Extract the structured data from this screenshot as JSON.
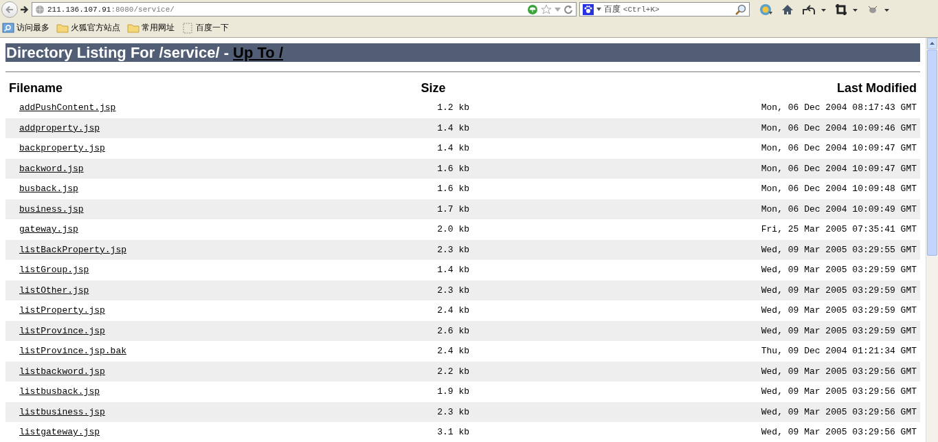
{
  "browser": {
    "url_host": "211.136.107.91",
    "url_path": ":8080/service/",
    "search_engine": "百度",
    "search_hint": "<Ctrl+K>",
    "bookmarks": [
      {
        "kind": "search",
        "label": "访问最多"
      },
      {
        "kind": "folder",
        "label": "火狐官方站点"
      },
      {
        "kind": "folder",
        "label": "常用网址"
      },
      {
        "kind": "page",
        "label": "百度一下"
      }
    ]
  },
  "page": {
    "heading": "Directory Listing For /service/ - ",
    "up_link": "Up To /",
    "columns": [
      "Filename",
      "Size",
      "Last Modified"
    ],
    "rows": [
      {
        "name": "addPushContent.jsp",
        "size": "1.2 kb",
        "modified": "Mon, 06 Dec 2004 08:17:43 GMT"
      },
      {
        "name": "addproperty.jsp",
        "size": "1.4 kb",
        "modified": "Mon, 06 Dec 2004 10:09:46 GMT"
      },
      {
        "name": "backproperty.jsp",
        "size": "1.4 kb",
        "modified": "Mon, 06 Dec 2004 10:09:47 GMT"
      },
      {
        "name": "backword.jsp",
        "size": "1.6 kb",
        "modified": "Mon, 06 Dec 2004 10:09:47 GMT"
      },
      {
        "name": "busback.jsp",
        "size": "1.6 kb",
        "modified": "Mon, 06 Dec 2004 10:09:48 GMT"
      },
      {
        "name": "business.jsp",
        "size": "1.7 kb",
        "modified": "Mon, 06 Dec 2004 10:09:49 GMT"
      },
      {
        "name": "gateway.jsp",
        "size": "2.0 kb",
        "modified": "Fri, 25 Mar 2005 07:35:41 GMT"
      },
      {
        "name": "listBackProperty.jsp",
        "size": "2.3 kb",
        "modified": "Wed, 09 Mar 2005 03:29:55 GMT"
      },
      {
        "name": "listGroup.jsp",
        "size": "1.4 kb",
        "modified": "Wed, 09 Mar 2005 03:29:59 GMT"
      },
      {
        "name": "listOther.jsp",
        "size": "2.3 kb",
        "modified": "Wed, 09 Mar 2005 03:29:59 GMT"
      },
      {
        "name": "listProperty.jsp",
        "size": "2.4 kb",
        "modified": "Wed, 09 Mar 2005 03:29:59 GMT"
      },
      {
        "name": "listProvince.jsp",
        "size": "2.6 kb",
        "modified": "Wed, 09 Mar 2005 03:29:59 GMT"
      },
      {
        "name": "listProvince.jsp.bak",
        "size": "2.4 kb",
        "modified": "Thu, 09 Dec 2004 01:21:34 GMT"
      },
      {
        "name": "listbackword.jsp",
        "size": "2.2 kb",
        "modified": "Wed, 09 Mar 2005 03:29:56 GMT"
      },
      {
        "name": "listbusback.jsp",
        "size": "1.9 kb",
        "modified": "Wed, 09 Mar 2005 03:29:56 GMT"
      },
      {
        "name": "listbusiness.jsp",
        "size": "2.3 kb",
        "modified": "Wed, 09 Mar 2005 03:29:56 GMT"
      },
      {
        "name": "listgateway.jsp",
        "size": "3.1 kb",
        "modified": "Wed, 09 Mar 2005 03:29:56 GMT"
      }
    ]
  }
}
